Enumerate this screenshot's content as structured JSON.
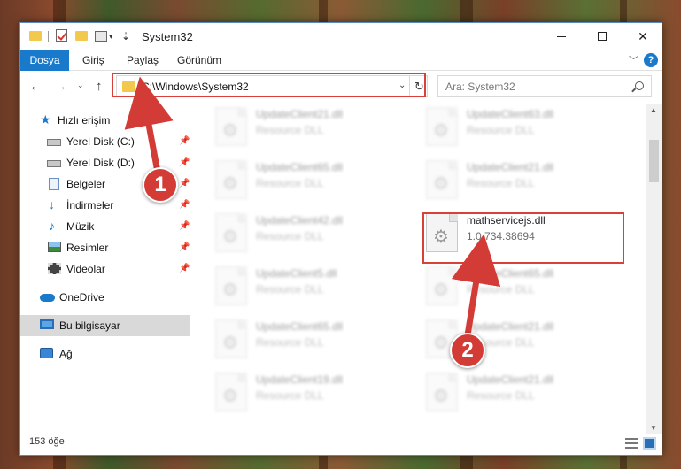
{
  "window": {
    "title": "System32",
    "controls": {
      "minimize": "minimize",
      "maximize": "maximize",
      "close": "✕"
    }
  },
  "ribbon": {
    "file_tab": "Dosya",
    "tabs": [
      "Giriş",
      "Paylaş",
      "Görünüm"
    ],
    "help": "?"
  },
  "address": {
    "path": "C:\\Windows\\System32",
    "search_placeholder": "Ara: System32"
  },
  "sidebar": {
    "quick_access": "Hızlı erişim",
    "items": [
      {
        "label": "Yerel Disk (C:)",
        "icon": "drive-icon",
        "pinned": true
      },
      {
        "label": "Yerel Disk (D:)",
        "icon": "drive-icon",
        "pinned": true
      },
      {
        "label": "Belgeler",
        "icon": "documents-icon",
        "pinned": true
      },
      {
        "label": "İndirmeler",
        "icon": "downloads-icon",
        "pinned": true
      },
      {
        "label": "Müzik",
        "icon": "music-icon",
        "pinned": true
      },
      {
        "label": "Resimler",
        "icon": "pictures-icon",
        "pinned": true
      },
      {
        "label": "Videolar",
        "icon": "videos-icon",
        "pinned": true
      }
    ],
    "onedrive": "OneDrive",
    "this_pc": "Bu bilgisayar",
    "network": "Ağ"
  },
  "files": {
    "left": [
      {
        "name": "UpdateClient21.dll",
        "sub": "Resource DLL"
      },
      {
        "name": "UpdateClient65.dll",
        "sub": "Resource DLL"
      },
      {
        "name": "UpdateClient42.dll",
        "sub": "Resource DLL"
      },
      {
        "name": "UpdateClient5.dll",
        "sub": "Resource DLL"
      },
      {
        "name": "UpdateClient65.dll",
        "sub": "Resource DLL"
      },
      {
        "name": "UpdateClient19.dll",
        "sub": "Resource DLL"
      }
    ],
    "right": [
      {
        "name": "UpdateClient63.dll",
        "sub": "Resource DLL"
      },
      {
        "name": "UpdateClient21.dll",
        "sub": "Resource DLL"
      },
      {
        "name": "mathservicejs.dll",
        "sub": "1.0.734.38694"
      },
      {
        "name": "UpdateClient65.dll",
        "sub": "Resource DLL"
      },
      {
        "name": "UpdateClient21.dll",
        "sub": "Resource DLL"
      },
      {
        "name": "UpdateClient21.dll",
        "sub": "Resource DLL"
      }
    ]
  },
  "status": {
    "count": "153 öğe"
  },
  "annotations": {
    "badge1": "1",
    "badge2": "2",
    "highlight_color": "#d9403a"
  },
  "colors": {
    "accent": "#1979ca",
    "window_border": "#5a8ac0",
    "selected_bg": "#d9d9d9"
  }
}
